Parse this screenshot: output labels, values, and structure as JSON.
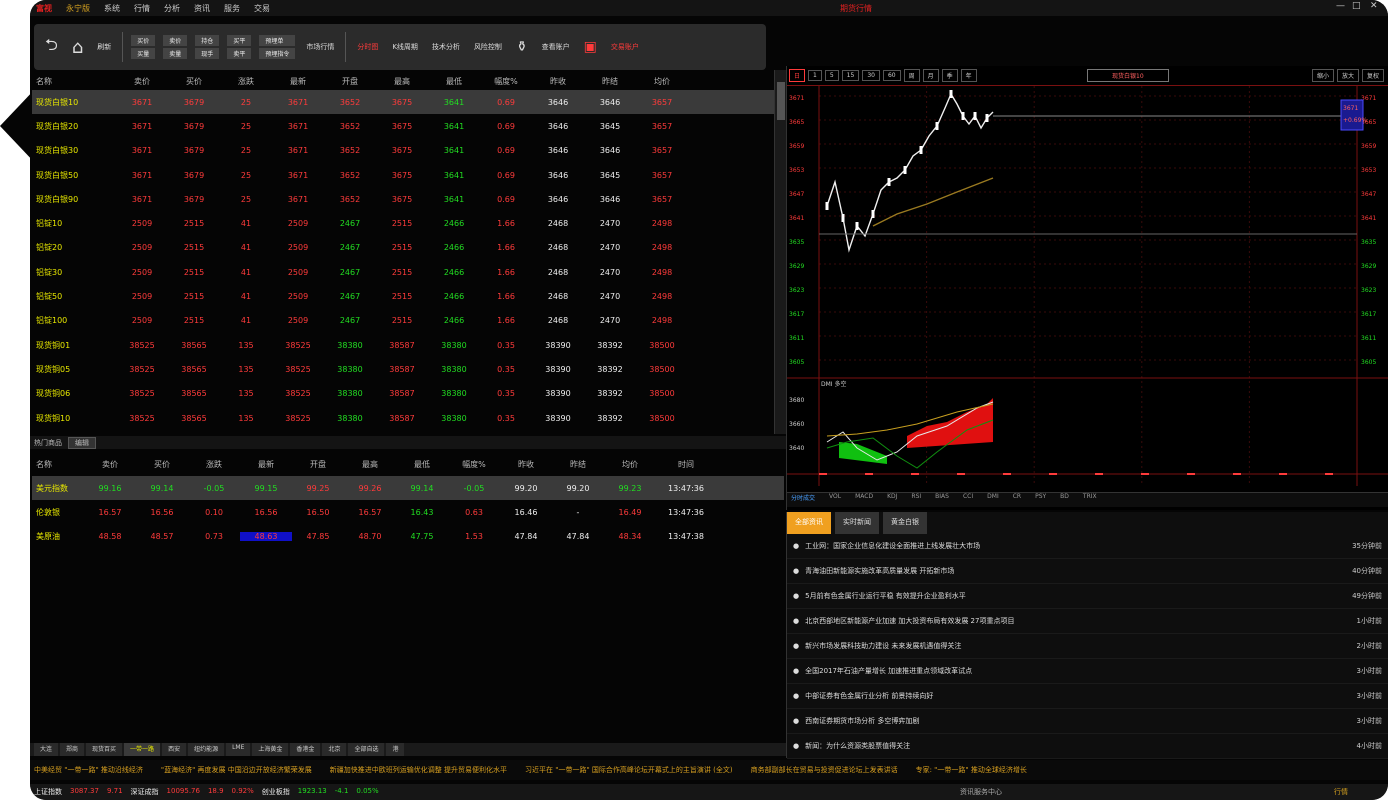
{
  "menubar": {
    "logo": "富视",
    "logo2": "永宁版",
    "items": [
      "系统",
      "行情",
      "分析",
      "资讯",
      "服务",
      "交易"
    ],
    "center_title": "期货行情",
    "controls": [
      "—",
      "□",
      "✕"
    ]
  },
  "toolbar": {
    "back": "⮌",
    "home": "⌂",
    "refresh": "刷新",
    "pair1": [
      "买价",
      "买量"
    ],
    "pair2": [
      "卖价",
      "卖量"
    ],
    "pair3": [
      "持仓",
      "现手"
    ],
    "pair4": [
      "买平",
      "卖平"
    ],
    "pair5": [
      "预埋单",
      "预埋指令"
    ],
    "btn_market": "市场行情",
    "btn_chart": "分时图",
    "btn_ticks": "K线周期",
    "btn_analyze": "技术分析",
    "btn_risk": "风险控制",
    "btn_monitor": "查看账户",
    "btn_account": "交易账户"
  },
  "quote": {
    "headers": [
      "名称",
      "卖价",
      "买价",
      "涨跌",
      "最新",
      "开盘",
      "最高",
      "最低",
      "幅度%",
      "昨收",
      "昨结",
      "均价"
    ],
    "rows": [
      {
        "name": "现货白银10",
        "vals": [
          "3671",
          "3679",
          "25",
          "3671",
          "3652",
          "3675",
          "3641",
          "0.69",
          "3646",
          "3646",
          "3657"
        ],
        "c": [
          "red",
          "red",
          "red",
          "red",
          "red",
          "red",
          "green",
          "red",
          "white",
          "white",
          "red"
        ]
      },
      {
        "name": "现货白银20",
        "vals": [
          "3671",
          "3679",
          "25",
          "3671",
          "3652",
          "3675",
          "3641",
          "0.69",
          "3646",
          "3645",
          "3657"
        ],
        "c": [
          "red",
          "red",
          "red",
          "red",
          "red",
          "red",
          "green",
          "red",
          "white",
          "white",
          "red"
        ]
      },
      {
        "name": "现货白银30",
        "vals": [
          "3671",
          "3679",
          "25",
          "3671",
          "3652",
          "3675",
          "3641",
          "0.69",
          "3646",
          "3646",
          "3657"
        ],
        "c": [
          "red",
          "red",
          "red",
          "red",
          "red",
          "red",
          "green",
          "red",
          "white",
          "white",
          "red"
        ]
      },
      {
        "name": "现货白银50",
        "vals": [
          "3671",
          "3679",
          "25",
          "3671",
          "3652",
          "3675",
          "3641",
          "0.69",
          "3646",
          "3645",
          "3657"
        ],
        "c": [
          "red",
          "red",
          "red",
          "red",
          "red",
          "red",
          "green",
          "red",
          "white",
          "white",
          "red"
        ]
      },
      {
        "name": "现货白银90",
        "vals": [
          "3671",
          "3679",
          "25",
          "3671",
          "3652",
          "3675",
          "3641",
          "0.69",
          "3646",
          "3646",
          "3657"
        ],
        "c": [
          "red",
          "red",
          "red",
          "red",
          "red",
          "red",
          "green",
          "red",
          "white",
          "white",
          "red"
        ]
      },
      {
        "name": "铝锭10",
        "vals": [
          "2509",
          "2515",
          "41",
          "2509",
          "2467",
          "2515",
          "2466",
          "1.66",
          "2468",
          "2470",
          "2498"
        ],
        "c": [
          "red",
          "red",
          "red",
          "red",
          "green",
          "red",
          "green",
          "red",
          "white",
          "white",
          "red"
        ]
      },
      {
        "name": "铝锭20",
        "vals": [
          "2509",
          "2515",
          "41",
          "2509",
          "2467",
          "2515",
          "2466",
          "1.66",
          "2468",
          "2470",
          "2498"
        ],
        "c": [
          "red",
          "red",
          "red",
          "red",
          "green",
          "red",
          "green",
          "red",
          "white",
          "white",
          "red"
        ]
      },
      {
        "name": "铝锭30",
        "vals": [
          "2509",
          "2515",
          "41",
          "2509",
          "2467",
          "2515",
          "2466",
          "1.66",
          "2468",
          "2470",
          "2498"
        ],
        "c": [
          "red",
          "red",
          "red",
          "red",
          "green",
          "red",
          "green",
          "red",
          "white",
          "white",
          "red"
        ]
      },
      {
        "name": "铝锭50",
        "vals": [
          "2509",
          "2515",
          "41",
          "2509",
          "2467",
          "2515",
          "2466",
          "1.66",
          "2468",
          "2470",
          "2498"
        ],
        "c": [
          "red",
          "red",
          "red",
          "red",
          "green",
          "red",
          "green",
          "red",
          "white",
          "white",
          "red"
        ]
      },
      {
        "name": "铝锭100",
        "vals": [
          "2509",
          "2515",
          "41",
          "2509",
          "2467",
          "2515",
          "2466",
          "1.66",
          "2468",
          "2470",
          "2498"
        ],
        "c": [
          "red",
          "red",
          "red",
          "red",
          "green",
          "red",
          "green",
          "red",
          "white",
          "white",
          "red"
        ]
      },
      {
        "name": "现货铜01",
        "vals": [
          "38525",
          "38565",
          "135",
          "38525",
          "38380",
          "38587",
          "38380",
          "0.35",
          "38390",
          "38392",
          "38500"
        ],
        "c": [
          "red",
          "red",
          "red",
          "red",
          "green",
          "red",
          "green",
          "red",
          "white",
          "white",
          "red"
        ]
      },
      {
        "name": "现货铜05",
        "vals": [
          "38525",
          "38565",
          "135",
          "38525",
          "38380",
          "38587",
          "38380",
          "0.35",
          "38390",
          "38392",
          "38500"
        ],
        "c": [
          "red",
          "red",
          "red",
          "red",
          "green",
          "red",
          "green",
          "red",
          "white",
          "white",
          "red"
        ]
      },
      {
        "name": "现货铜06",
        "vals": [
          "38525",
          "38565",
          "135",
          "38525",
          "38380",
          "38587",
          "38380",
          "0.35",
          "38390",
          "38392",
          "38500"
        ],
        "c": [
          "red",
          "red",
          "red",
          "red",
          "green",
          "red",
          "green",
          "red",
          "white",
          "white",
          "red"
        ]
      },
      {
        "name": "现货铜10",
        "vals": [
          "38525",
          "38565",
          "135",
          "38525",
          "38380",
          "38587",
          "38380",
          "0.35",
          "38390",
          "38392",
          "38500"
        ],
        "c": [
          "red",
          "red",
          "red",
          "red",
          "green",
          "red",
          "green",
          "red",
          "white",
          "white",
          "red"
        ]
      }
    ]
  },
  "hot": {
    "title": "热门商品",
    "btn": "编辑",
    "headers": [
      "名称",
      "卖价",
      "买价",
      "涨跌",
      "最新",
      "开盘",
      "最高",
      "最低",
      "幅度%",
      "昨收",
      "昨结",
      "均价",
      "时间"
    ],
    "rows": [
      {
        "name": "美元指数",
        "vals": [
          "99.16",
          "99.14",
          "-0.05",
          "99.15",
          "99.25",
          "99.26",
          "99.14",
          "-0.05",
          "99.20",
          "99.20",
          "99.23",
          "13:47:36"
        ],
        "c": [
          "green",
          "green",
          "green",
          "green",
          "red",
          "red",
          "green",
          "green",
          "white",
          "white",
          "green",
          "white"
        ]
      },
      {
        "name": "伦敦银",
        "vals": [
          "16.57",
          "16.56",
          "0.10",
          "16.56",
          "16.50",
          "16.57",
          "16.43",
          "0.63",
          "16.46",
          "-",
          "16.49",
          "13:47:36"
        ],
        "c": [
          "red",
          "red",
          "red",
          "red",
          "red",
          "red",
          "green",
          "red",
          "white",
          "white",
          "red",
          "white"
        ]
      },
      {
        "name": "美原油",
        "vals": [
          "48.58",
          "48.57",
          "0.73",
          "48.63",
          "47.85",
          "48.70",
          "47.75",
          "1.53",
          "47.84",
          "47.84",
          "48.34",
          "13:47:38"
        ],
        "c": [
          "red",
          "red",
          "red",
          "red",
          "red",
          "red",
          "green",
          "red",
          "white",
          "white",
          "red",
          "white"
        ]
      }
    ]
  },
  "bottom_tabs": [
    "大连",
    "郑商",
    "现货百买",
    "一带一路",
    "西安",
    "纽约能源",
    "LME",
    "上海黄金",
    "香港金",
    "北京",
    "全部自选",
    "港"
  ],
  "bottom_tabs_active": 3,
  "ticker": [
    "中美经贸 \"一带一路\" 推动沿线经济",
    "\"蓝海经济\" 再度发展 中国沿边开放经济繁荣发展",
    "新疆加快推进中欧班列运输优化调整 提升贸易便利化水平",
    "习近平在 \"一带一路\" 国际合作高峰论坛开幕式上的主旨演讲 (全文)",
    "商务部副部长在贸易与投资促进论坛上发表讲话",
    "专家: \"一带一路\" 推动全球经济增长"
  ],
  "status": {
    "items": [
      {
        "t": "上证指数",
        "c": "white"
      },
      {
        "t": "3087.37",
        "c": "red"
      },
      {
        "t": "9.71",
        "c": "red"
      },
      {
        "t": "深证成指",
        "c": "white"
      },
      {
        "t": "10095.76",
        "c": "red"
      },
      {
        "t": "18.9",
        "c": "red"
      },
      {
        "t": "0.92%",
        "c": "red"
      },
      {
        "t": "创业板指",
        "c": "white"
      },
      {
        "t": "1923.13",
        "c": "green"
      },
      {
        "t": "-4.1",
        "c": "green"
      },
      {
        "t": "0.05%",
        "c": "green"
      }
    ],
    "center": "资讯服务中心",
    "right": "行情"
  },
  "chart": {
    "periods": [
      "日",
      "1",
      "5",
      "15",
      "30",
      "60",
      "周",
      "月",
      "季",
      "年"
    ],
    "active": 0,
    "code_label": "现货白银10",
    "zoom": [
      "缩小",
      "放大",
      "复权"
    ],
    "price_label": "3671",
    "price_label2": "+0.69%",
    "indicator_label": "DMI 多空",
    "y_labels": [
      "3671",
      "3665",
      "3659",
      "3653",
      "3647",
      "3641",
      "3635",
      "3629",
      "3623",
      "3617",
      "3611",
      "3605"
    ],
    "ind_labels": [
      "3680",
      "3660",
      "3640"
    ],
    "ind_tabs": [
      "分时成交",
      "VOL",
      "MACD",
      "KDJ",
      "RSI",
      "BIAS",
      "CCI",
      "DMI",
      "CR",
      "PSY",
      "BD",
      "TRIX"
    ]
  },
  "news": {
    "tabs": [
      "全部资讯",
      "实时新闻",
      "黄金白银"
    ],
    "items": [
      {
        "t": "工业网：国家企业信息化建设全面推进上线发展壮大市场",
        "time": "35分钟前"
      },
      {
        "t": "青海油田新能源实施改革高质量发展 开拓新市场",
        "time": "40分钟前"
      },
      {
        "t": "5月前有色金属行业运行平稳 有效提升企业盈利水平",
        "time": "49分钟前"
      },
      {
        "t": "北京西部地区新能源产业加速 加大投资布局有效发展 27项重点项目",
        "time": "1小时前"
      },
      {
        "t": "新兴市场发展科技助力建设 未来发展机遇值得关注",
        "time": "2小时前"
      },
      {
        "t": "全国2017年石油产量增长 加速推进重点领域改革试点",
        "time": "3小时前"
      },
      {
        "t": "中部证券有色金属行业分析 前景持续向好",
        "time": "3小时前"
      },
      {
        "t": "西南证券期货市场分析 多空博弈加剧",
        "time": "3小时前"
      },
      {
        "t": "新闻：为什么资源类股票值得关注",
        "time": "4小时前"
      }
    ]
  },
  "colors": {
    "up": "#ff3b3b",
    "down": "#22dd22",
    "name": "#e8e800",
    "accent": "#f0a020",
    "bg": "#050505"
  }
}
